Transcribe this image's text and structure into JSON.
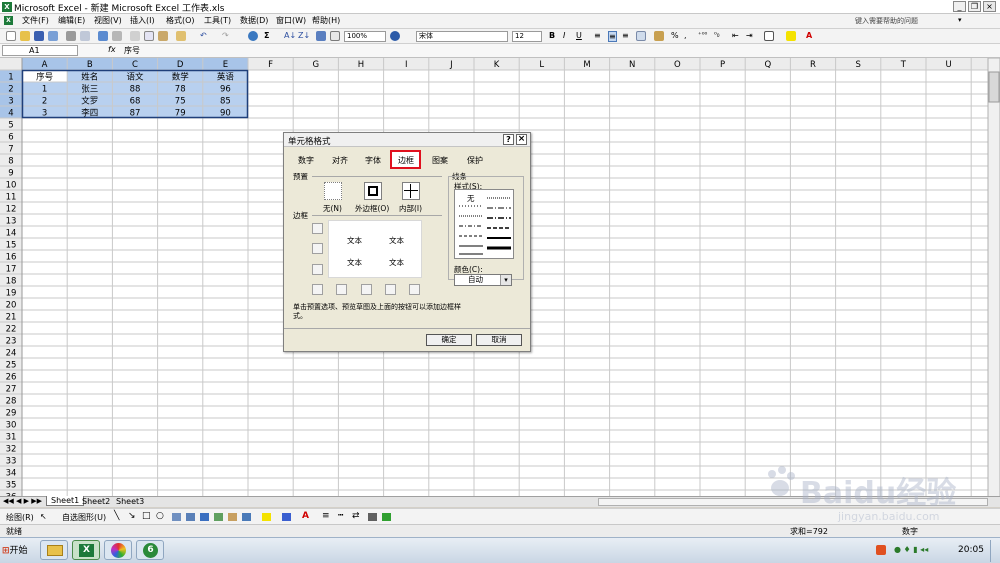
{
  "window": {
    "title": "Microsoft Excel - 新建 Microsoft Excel 工作表.xls",
    "help_placeholder": "键入需要帮助的问题"
  },
  "menu": [
    "文件(F)",
    "编辑(E)",
    "视图(V)",
    "插入(I)",
    "格式(O)",
    "工具(T)",
    "数据(D)",
    "窗口(W)",
    "帮助(H)"
  ],
  "toolbar": {
    "zoom": "100%",
    "font": "宋体",
    "font_size": "12",
    "bold": "B",
    "italic": "I",
    "underline": "U",
    "percent": "%"
  },
  "formula_bar": {
    "name_box": "A1",
    "fx": "fx",
    "content": "序号"
  },
  "grid": {
    "columns": [
      "A",
      "B",
      "C",
      "D",
      "E",
      "F",
      "G",
      "H",
      "I",
      "J",
      "K",
      "L",
      "M",
      "N",
      "O",
      "P",
      "Q",
      "R",
      "S",
      "T",
      "U"
    ],
    "row_count": 36,
    "headers": [
      "序号",
      "姓名",
      "语文",
      "数学",
      "英语"
    ],
    "rows": [
      [
        "1",
        "张三",
        "88",
        "78",
        "96"
      ],
      [
        "2",
        "文罗",
        "68",
        "75",
        "85"
      ],
      [
        "3",
        "李四",
        "87",
        "79",
        "90"
      ]
    ]
  },
  "dialog": {
    "title": "单元格格式",
    "help": "?",
    "close": "×",
    "tabs": [
      "数字",
      "对齐",
      "字体",
      "边框",
      "图案",
      "保护"
    ],
    "active_tab": "边框",
    "preset_label": "预置",
    "presets": [
      "无(N)",
      "外边框(O)",
      "内部(I)"
    ],
    "border_label": "边框",
    "preview_text": "文本",
    "line_label": "线条",
    "style_label": "样式(S):",
    "style_none": "无",
    "color_label": "颜色(C):",
    "color_value": "自动",
    "hint": "单击预置选项、预览草图及上面的按钮可以添加边框样式。",
    "ok": "确定",
    "cancel": "取消"
  },
  "sheets": [
    "Sheet1",
    "Sheet2",
    "Sheet3"
  ],
  "drawing": {
    "draw_label": "绘图(R)",
    "autoshapes_label": "自选图形(U)"
  },
  "status": {
    "ready": "就绪",
    "sum": "求和=792",
    "mode": "数字"
  },
  "taskbar": {
    "start": "开始",
    "clock": "20:05"
  },
  "watermark": {
    "brand": "Baidu经验",
    "url": "jingyan.baidu.com"
  },
  "colors": {
    "selection": "#b8d0ef",
    "highlight_box": "#e0101e",
    "excel_green": "#1d7a3a"
  }
}
